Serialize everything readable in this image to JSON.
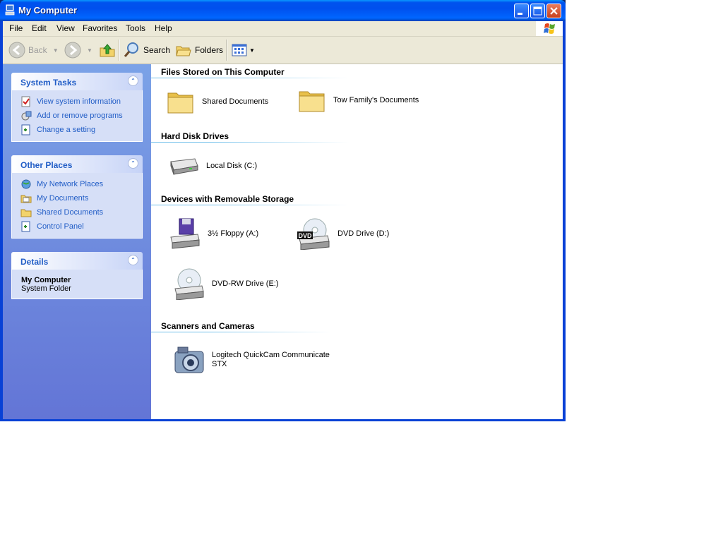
{
  "window": {
    "title": "My Computer"
  },
  "menu": [
    "File",
    "Edit",
    "View",
    "Favorites",
    "Tools",
    "Help"
  ],
  "toolbar": {
    "back": "Back",
    "search": "Search",
    "folders": "Folders"
  },
  "left_pane": {
    "system_tasks": {
      "title": "System Tasks",
      "items": [
        "View system information",
        "Add or remove programs",
        "Change a setting"
      ]
    },
    "other_places": {
      "title": "Other Places",
      "items": [
        "My Network Places",
        "My Documents",
        "Shared Documents",
        "Control Panel"
      ]
    },
    "details": {
      "title": "Details",
      "name": "My Computer",
      "type": "System Folder"
    }
  },
  "groups": {
    "files": {
      "title": "Files Stored on This Computer",
      "items": [
        "Shared Documents",
        "Tow Family's Documents"
      ]
    },
    "hdd": {
      "title": "Hard Disk Drives",
      "items": [
        "Local Disk (C:)"
      ]
    },
    "removable": {
      "title": "Devices with Removable Storage",
      "items": [
        "3½ Floppy (A:)",
        "DVD Drive (D:)",
        "DVD-RW Drive (E:)"
      ]
    },
    "scanners": {
      "title": "Scanners and Cameras",
      "items": [
        "Logitech QuickCam Communicate",
        "STX"
      ]
    }
  },
  "icons": {
    "dvd_badge": "DVD"
  },
  "colors": {
    "accent": "#215dc6",
    "titlebar": "#0053ee",
    "pane": "#6375d6"
  }
}
